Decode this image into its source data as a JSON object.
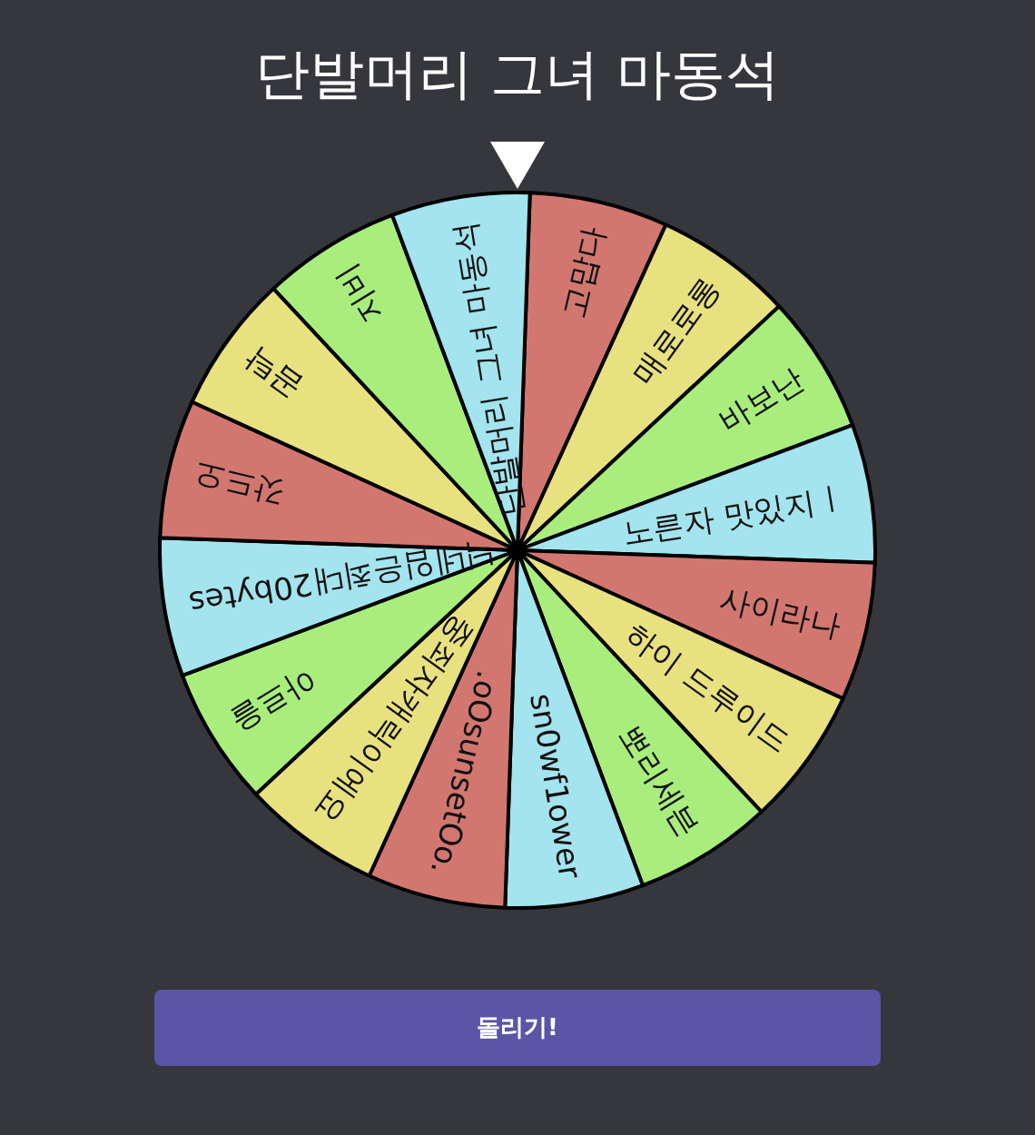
{
  "title": "단발머리 그녀 마동석",
  "segments": [
    {
      "label": "고맙다",
      "color": "#d27770"
    },
    {
      "label": "매로로롱",
      "color": "#e8e17f"
    },
    {
      "label": "바보난",
      "color": "#a9ee7d"
    },
    {
      "label": "노른자 맛있지ㅣ",
      "color": "#a3e4ee"
    },
    {
      "label": "사이라나",
      "color": "#d27770"
    },
    {
      "label": "하이 드루이드",
      "color": "#e8e17f"
    },
    {
      "label": "뽀리세븐",
      "color": "#a9ee7d"
    },
    {
      "label": "sn0wf1ower",
      "color": "#a3e4ee"
    },
    {
      "label": ".oOsunsetOo.",
      "color": "#d27770"
    },
    {
      "label": "중죄자캐릭이에요",
      "color": "#e8e17f"
    },
    {
      "label": "아르을",
      "color": "#a9ee7d"
    },
    {
      "label": "닉네임은최대20bytes",
      "color": "#a3e4ee"
    },
    {
      "label": "갓드오",
      "color": "#d27770"
    },
    {
      "label": "곰탁",
      "color": "#e8e17f"
    },
    {
      "label": "지비",
      "color": "#a9ee7d"
    },
    {
      "label": "단발머리 그녀 마동석",
      "color": "#a3e4ee"
    }
  ],
  "button": "돌리기!"
}
